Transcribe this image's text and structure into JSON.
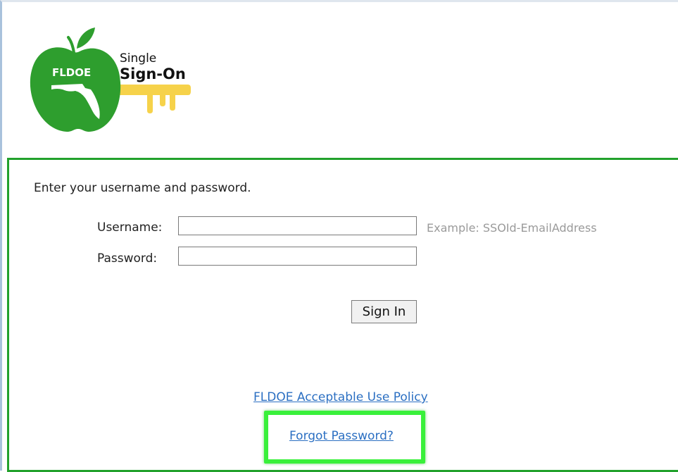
{
  "logo": {
    "org_text": "FLDOE",
    "title_line1": "Single",
    "title_line2": "Sign-On",
    "colors": {
      "apple": "#2e9e2e",
      "key": "#f6d24a",
      "leaf": "#2e9e2e"
    }
  },
  "login": {
    "instructions": "Enter your username and password.",
    "username_label": "Username:",
    "username_value": "",
    "username_hint": "Example: SSOId-EmailAddress",
    "password_label": "Password:",
    "password_value": "",
    "signin_label": "Sign In"
  },
  "links": {
    "acceptable_use": "FLDOE Acceptable Use Policy",
    "forgot_password": "Forgot Password?"
  },
  "colors": {
    "panel_border": "#22a12c",
    "link": "#2b6fc2",
    "highlight": "#39f03a",
    "frame_border": "#a9c2dc"
  }
}
